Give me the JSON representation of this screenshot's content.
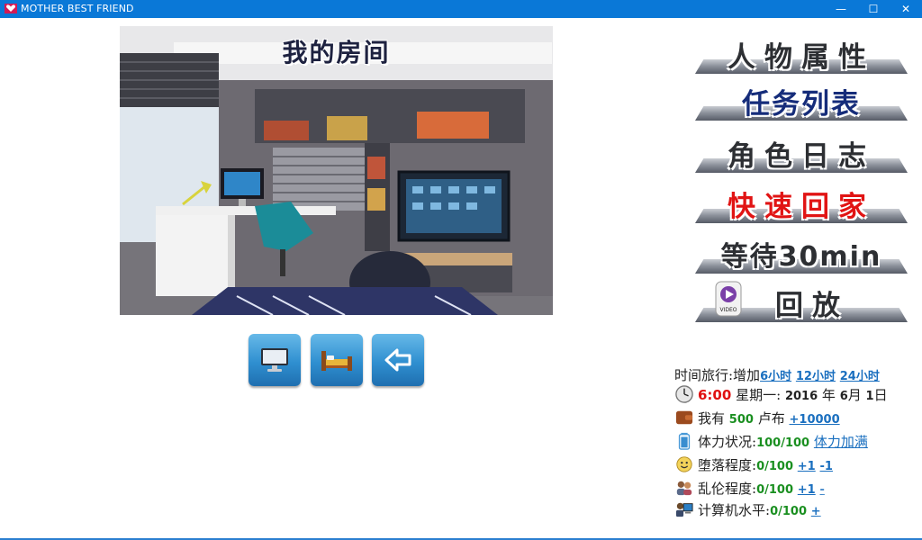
{
  "window": {
    "title": "MOTHER BEST FRIEND",
    "min": "—",
    "max": "☐",
    "close": "✕"
  },
  "room": {
    "title": "我的房间"
  },
  "actions": [
    {
      "name": "computer",
      "icon": "monitor-icon"
    },
    {
      "name": "bed",
      "icon": "bed-icon"
    },
    {
      "name": "back",
      "icon": "back-arrow-icon"
    }
  ],
  "menu": {
    "attributes": "人物属性",
    "tasks": "任务列表",
    "diary": "角色日志",
    "go_home": "快速回家",
    "wait": "等待30min",
    "replay": "回放",
    "video_badge": "VIDEO"
  },
  "status": {
    "time_travel": {
      "label": "时间旅行:增加",
      "h6": "6小时",
      "h12": "12小时",
      "h24": "24小时"
    },
    "clock": {
      "time": "6:00",
      "weekday": "星期一:",
      "year": "2016",
      "year_unit": "年",
      "month": "6",
      "month_unit": "月",
      "day": "1",
      "day_unit": "日"
    },
    "money": {
      "prefix": "我有",
      "amount": "500",
      "unit": "卢布",
      "add": "+10000"
    },
    "stamina": {
      "label": "体力状况:",
      "value": "100/100",
      "refill": "体力加满"
    },
    "corruption": {
      "label": "堕落程度:",
      "value": "0/100",
      "plus": "+1",
      "minus": "-1"
    },
    "incest": {
      "label": "乱伦程度:",
      "value": "0/100",
      "plus": "+1",
      "minus": "-"
    },
    "computer": {
      "label": "计算机水平:",
      "value": "0/100",
      "plus": "+"
    }
  },
  "colors": {
    "titlebar": "#0a78d7",
    "accent_blue": "#152c7a",
    "accent_red": "#e11414",
    "link": "#1a6fbf",
    "green": "#1a8f20"
  }
}
